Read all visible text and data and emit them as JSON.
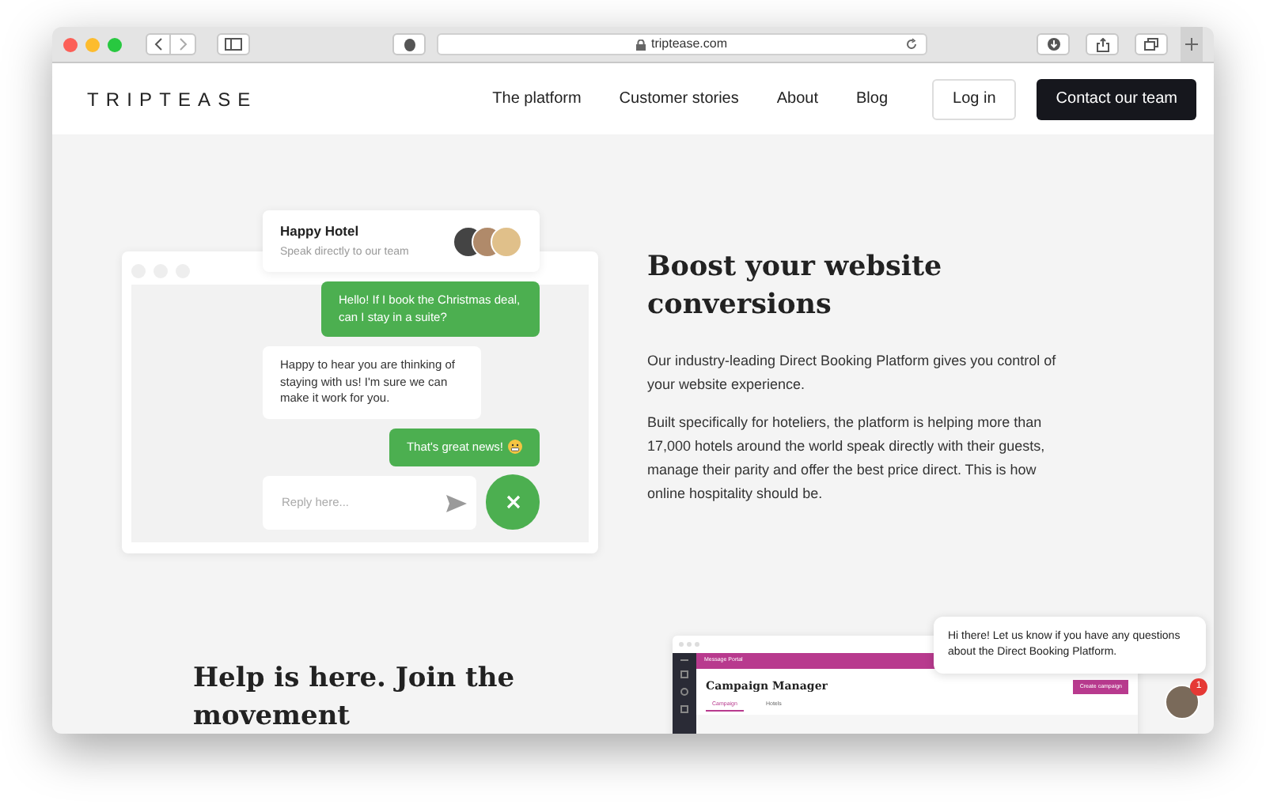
{
  "browser": {
    "url": "triptease.com"
  },
  "nav": {
    "logo": "TRIPTEASE",
    "links": [
      "The platform",
      "Customer stories",
      "About",
      "Blog"
    ],
    "login": "Log in",
    "cta": "Contact our team"
  },
  "chat_demo": {
    "hotel": "Happy Hotel",
    "subtitle": "Speak directly to our team",
    "reply_placeholder": "Reply here...",
    "messages": [
      {
        "kind": "guest",
        "text": "Hello! If I book the Christmas deal, can I stay in a suite?",
        "emoji": false
      },
      {
        "kind": "hotel",
        "text": "Happy to hear you are thinking of staying with us! I'm sure we can make it work for you.",
        "emoji": false
      },
      {
        "kind": "guest",
        "text": "That's great news!",
        "emoji": true
      }
    ]
  },
  "feature": {
    "heading": "Boost your website conversions",
    "paragraphs": [
      "Our industry-leading Direct Booking Platform gives you control of your website experience.",
      "Built specifically for hoteliers, the platform is helping more than 17,000 hotels around the world speak directly with their guests, manage their parity and offer the best price direct. This is how online hospitality should be."
    ]
  },
  "section_2": {
    "heading": "Help is here. Join the movement"
  },
  "app_preview": {
    "brand": "Message Portal",
    "title": "Campaign Manager",
    "button": "Create campaign",
    "tabs": [
      {
        "label": "Campaign",
        "selected": true
      },
      {
        "label": "Hotels",
        "selected": false
      }
    ]
  },
  "chat_popup": {
    "text": "Hi there! Let us know if you have any questions about the Direct Booking Platform.",
    "unread": "1"
  }
}
